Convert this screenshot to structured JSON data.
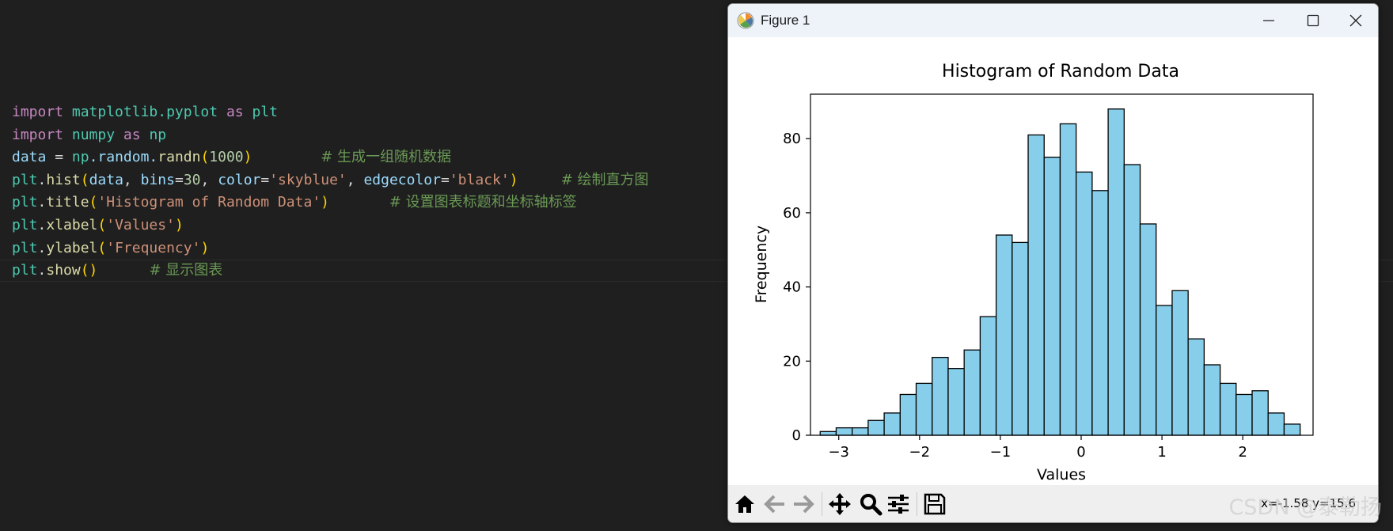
{
  "editor": {
    "lines": [
      {
        "tokens": [
          {
            "t": "import",
            "c": "kw"
          },
          {
            "t": " ",
            "c": "op"
          },
          {
            "t": "matplotlib.pyplot",
            "c": "mod"
          },
          {
            "t": " ",
            "c": "op"
          },
          {
            "t": "as",
            "c": "kw"
          },
          {
            "t": " ",
            "c": "op"
          },
          {
            "t": "plt",
            "c": "mod"
          }
        ]
      },
      {
        "tokens": [
          {
            "t": "import",
            "c": "kw"
          },
          {
            "t": " ",
            "c": "op"
          },
          {
            "t": "numpy",
            "c": "mod"
          },
          {
            "t": " ",
            "c": "op"
          },
          {
            "t": "as",
            "c": "kw"
          },
          {
            "t": " ",
            "c": "op"
          },
          {
            "t": "np",
            "c": "mod"
          }
        ]
      },
      {
        "tokens": [
          {
            "t": "data",
            "c": "var"
          },
          {
            "t": " = ",
            "c": "op"
          },
          {
            "t": "np",
            "c": "mod"
          },
          {
            "t": ".random.",
            "c": "var"
          },
          {
            "t": "randn",
            "c": "fn"
          },
          {
            "t": "(",
            "c": "p1"
          },
          {
            "t": "1000",
            "c": "num"
          },
          {
            "t": ")",
            "c": "p1"
          },
          {
            "t": "        ",
            "c": "op"
          },
          {
            "t": "# 生成一组随机数据",
            "c": "cm"
          }
        ]
      },
      {
        "tokens": [
          {
            "t": "plt",
            "c": "mod"
          },
          {
            "t": ".",
            "c": "op"
          },
          {
            "t": "hist",
            "c": "fn"
          },
          {
            "t": "(",
            "c": "p1"
          },
          {
            "t": "data",
            "c": "var"
          },
          {
            "t": ", ",
            "c": "op"
          },
          {
            "t": "bins",
            "c": "var"
          },
          {
            "t": "=",
            "c": "op"
          },
          {
            "t": "30",
            "c": "num"
          },
          {
            "t": ", ",
            "c": "op"
          },
          {
            "t": "color",
            "c": "var"
          },
          {
            "t": "=",
            "c": "op"
          },
          {
            "t": "'skyblue'",
            "c": "str"
          },
          {
            "t": ", ",
            "c": "op"
          },
          {
            "t": "edgecolor",
            "c": "var"
          },
          {
            "t": "=",
            "c": "op"
          },
          {
            "t": "'black'",
            "c": "str"
          },
          {
            "t": ")",
            "c": "p1"
          },
          {
            "t": "     ",
            "c": "op"
          },
          {
            "t": "# 绘制直方图",
            "c": "cm"
          }
        ]
      },
      {
        "tokens": [
          {
            "t": "plt",
            "c": "mod"
          },
          {
            "t": ".",
            "c": "op"
          },
          {
            "t": "title",
            "c": "fn"
          },
          {
            "t": "(",
            "c": "p1"
          },
          {
            "t": "'Histogram of Random Data'",
            "c": "str"
          },
          {
            "t": ")",
            "c": "p1"
          },
          {
            "t": "       ",
            "c": "op"
          },
          {
            "t": "# 设置图表标题和坐标轴标签",
            "c": "cm"
          }
        ]
      },
      {
        "tokens": [
          {
            "t": "plt",
            "c": "mod"
          },
          {
            "t": ".",
            "c": "op"
          },
          {
            "t": "xlabel",
            "c": "fn"
          },
          {
            "t": "(",
            "c": "p1"
          },
          {
            "t": "'Values'",
            "c": "str"
          },
          {
            "t": ")",
            "c": "p1"
          }
        ]
      },
      {
        "tokens": [
          {
            "t": "plt",
            "c": "mod"
          },
          {
            "t": ".",
            "c": "op"
          },
          {
            "t": "ylabel",
            "c": "fn"
          },
          {
            "t": "(",
            "c": "p1"
          },
          {
            "t": "'Frequency'",
            "c": "str"
          },
          {
            "t": ")",
            "c": "p1"
          }
        ]
      },
      {
        "tokens": [
          {
            "t": "plt",
            "c": "mod"
          },
          {
            "t": ".",
            "c": "op"
          },
          {
            "t": "show",
            "c": "fn"
          },
          {
            "t": "()",
            "c": "p1"
          },
          {
            "t": "      ",
            "c": "op"
          },
          {
            "t": "# 显示图表",
            "c": "cm"
          }
        ]
      }
    ]
  },
  "figure_window": {
    "title": "Figure 1",
    "coords": "x=-1.58  y=15.6"
  },
  "toolbar": {
    "buttons": [
      {
        "name": "home-icon"
      },
      {
        "name": "back-arrow-icon"
      },
      {
        "name": "forward-arrow-icon"
      },
      {
        "name": "pan-move-icon"
      },
      {
        "name": "zoom-magnifier-icon"
      },
      {
        "name": "configure-subplots-icon"
      },
      {
        "name": "save-figure-icon"
      }
    ]
  },
  "watermark": "CSDN @泰勒扬",
  "colors": {
    "bar_fill": "#87ceeb",
    "bar_edge": "#000000",
    "editor_bg": "#1f1f1f",
    "titlebar_bg": "#eef3fa"
  },
  "chart_data": {
    "type": "bar",
    "title": "Histogram of Random Data",
    "xlabel": "Values",
    "ylabel": "Frequency",
    "xlim": [
      -3.35,
      2.87
    ],
    "ylim": [
      0,
      92
    ],
    "xticks": [
      -3,
      -2,
      -1,
      0,
      1,
      2
    ],
    "xtick_labels": [
      "−3",
      "−2",
      "−1",
      "0",
      "1",
      "2"
    ],
    "yticks": [
      0,
      20,
      40,
      60,
      80
    ],
    "ytick_labels": [
      "0",
      "20",
      "40",
      "60",
      "80"
    ],
    "bin_start": -3.23,
    "bin_width": 0.198,
    "values": [
      1,
      2,
      2,
      4,
      6,
      11,
      14,
      21,
      18,
      23,
      32,
      54,
      52,
      81,
      75,
      84,
      71,
      66,
      88,
      73,
      57,
      35,
      39,
      26,
      19,
      14,
      11,
      12,
      6,
      3
    ],
    "grid": false,
    "legend": "none"
  }
}
